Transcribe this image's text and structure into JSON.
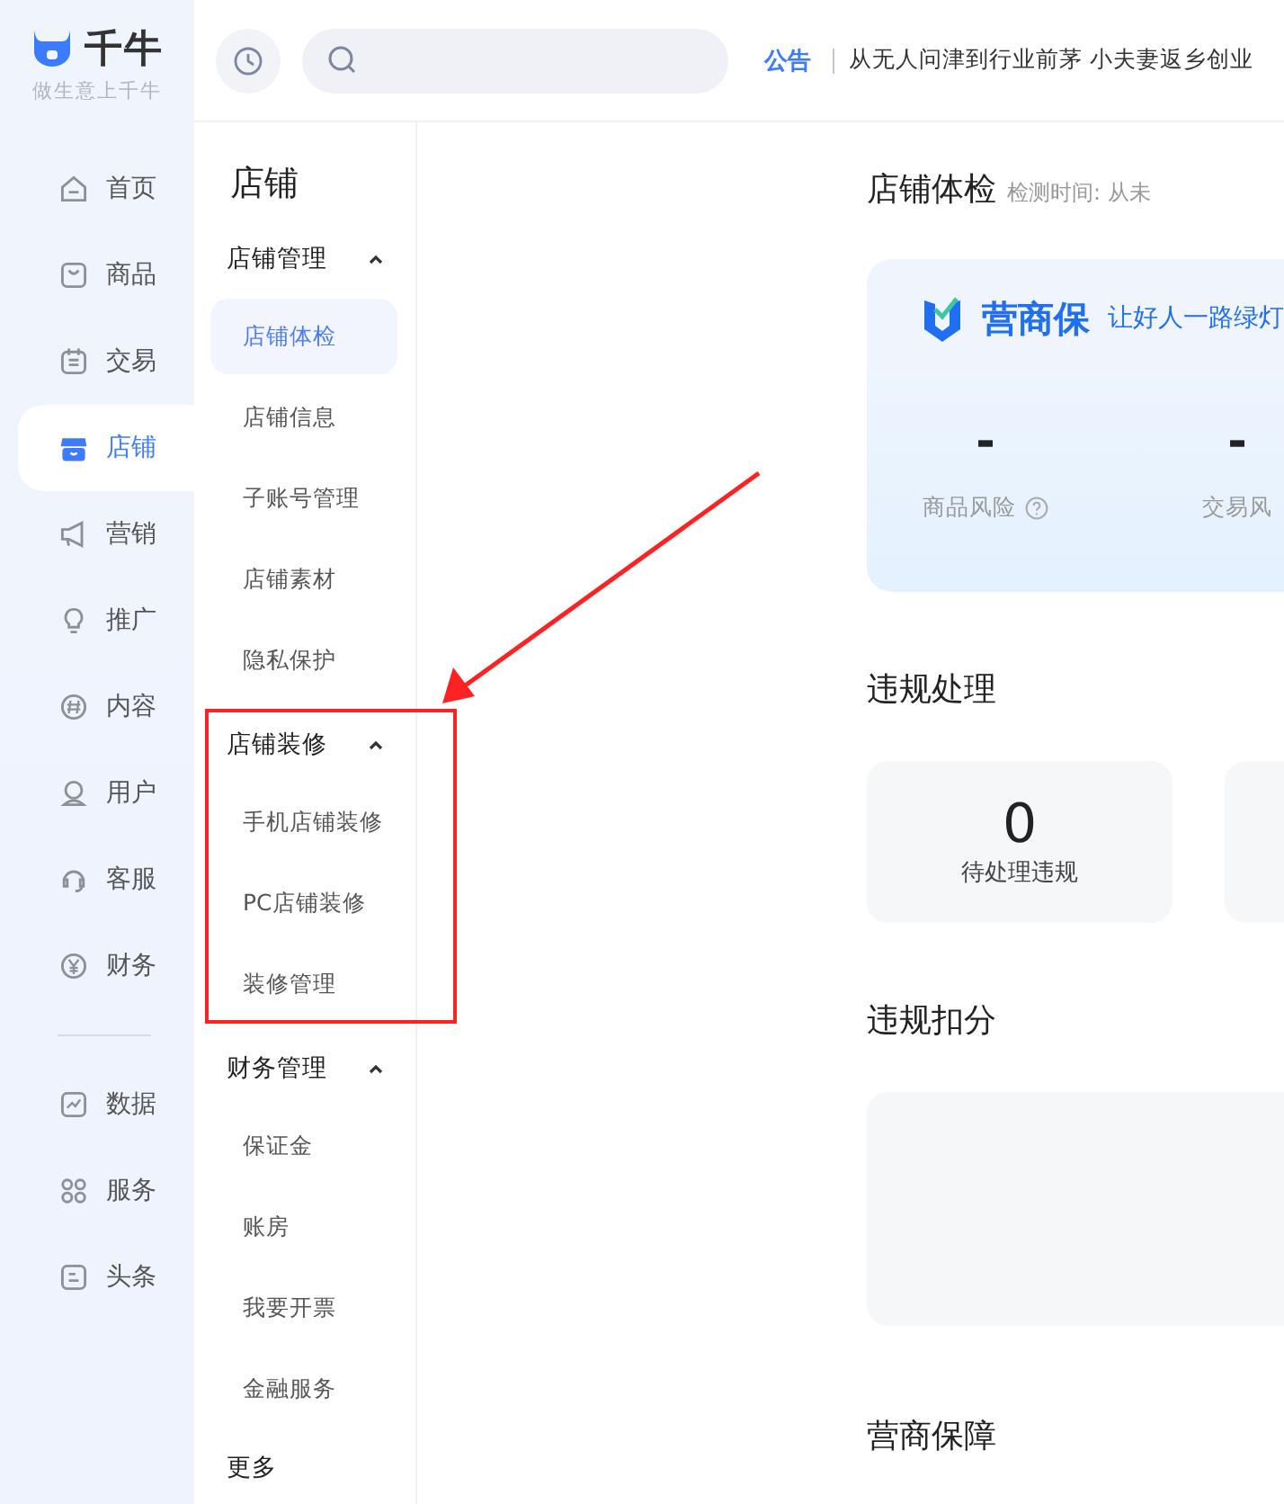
{
  "logo": {
    "name": "千牛",
    "slogan": "做生意上千牛"
  },
  "rail": {
    "groups": [
      {
        "items": [
          {
            "label": "首页",
            "selected": false
          },
          {
            "label": "商品",
            "selected": false
          },
          {
            "label": "交易",
            "selected": false
          },
          {
            "label": "店铺",
            "selected": true
          },
          {
            "label": "营销",
            "selected": false
          },
          {
            "label": "推广",
            "selected": false
          },
          {
            "label": "内容",
            "selected": false
          },
          {
            "label": "用户",
            "selected": false
          },
          {
            "label": "客服",
            "selected": false
          },
          {
            "label": "财务",
            "selected": false
          }
        ]
      },
      {
        "items": [
          {
            "label": "数据",
            "selected": false
          },
          {
            "label": "服务",
            "selected": false
          },
          {
            "label": "头条",
            "selected": false
          }
        ]
      }
    ]
  },
  "topbar": {
    "notice": {
      "tag": "公告",
      "text": "从无人问津到行业前茅 小夫妻返乡创业"
    }
  },
  "subnav": {
    "title": "店铺",
    "groups": [
      {
        "label": "店铺管理",
        "expanded": true,
        "highlighted": false,
        "items": [
          {
            "label": "店铺体检",
            "selected": true
          },
          {
            "label": "店铺信息",
            "selected": false
          },
          {
            "label": "子账号管理",
            "selected": false
          },
          {
            "label": "店铺素材",
            "selected": false
          },
          {
            "label": "隐私保护",
            "selected": false
          }
        ]
      },
      {
        "label": "店铺装修",
        "expanded": true,
        "highlighted": true,
        "items": [
          {
            "label": "手机店铺装修",
            "selected": false
          },
          {
            "label": "PC店铺装修",
            "selected": false
          },
          {
            "label": "装修管理",
            "selected": false
          }
        ]
      },
      {
        "label": "财务管理",
        "expanded": true,
        "highlighted": false,
        "items": [
          {
            "label": "保证金",
            "selected": false
          },
          {
            "label": "账房",
            "selected": false
          },
          {
            "label": "我要开票",
            "selected": false
          },
          {
            "label": "金融服务",
            "selected": false
          }
        ]
      }
    ],
    "more": "更多"
  },
  "main": {
    "check": {
      "title": "店铺体检",
      "meta": "检测时间: 从未",
      "banner": {
        "brand": "营商保",
        "tagline": "让好人一路绿灯"
      },
      "stats": [
        {
          "value": "-",
          "label": "商品风险",
          "help": true
        },
        {
          "value": "-",
          "label": "交易风",
          "help": false
        }
      ]
    },
    "violations": {
      "title": "违规处理",
      "cards": [
        {
          "kind": "count",
          "value": "0",
          "label": "待处理违规"
        },
        {
          "kind": "blank"
        }
      ]
    },
    "deductions": {
      "title": "违规扣分"
    },
    "guarantee": {
      "title": "营商保障"
    }
  }
}
